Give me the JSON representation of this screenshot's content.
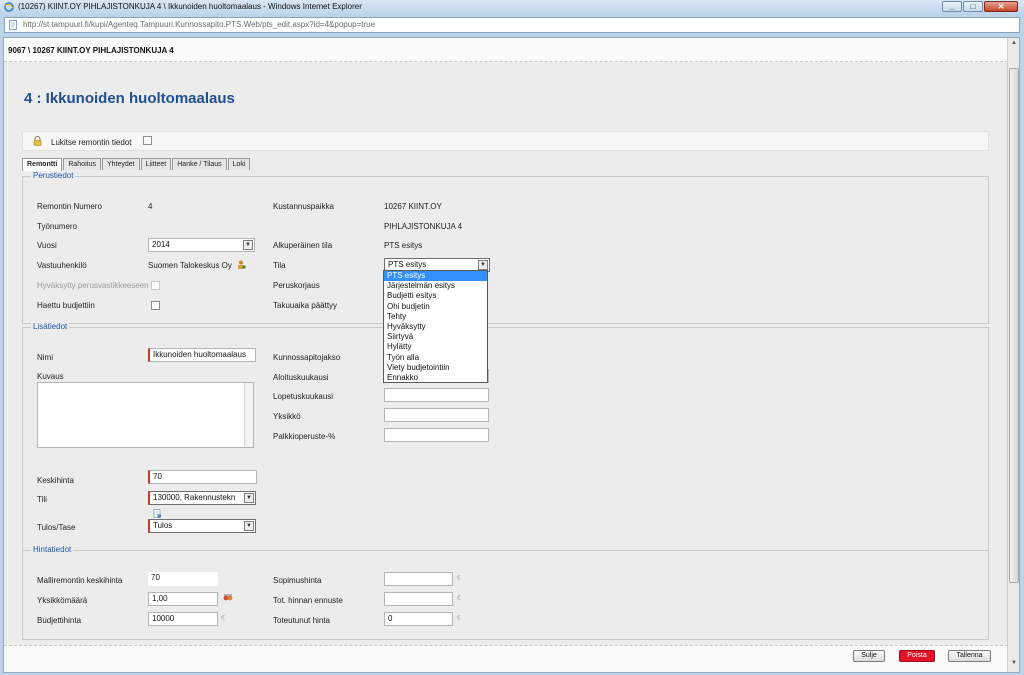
{
  "window": {
    "title": "(10267) KIINT.OY PIHLAJISTONKUJA 4 \\ Ikkunoiden huoltomaalaus - Windows Internet Explorer",
    "url": "http://st.tampuuri.fi/kupi/Agenteq.Tampuuri.Kunnossapito.PTS.Web/pts_edit.aspx?id=4&popup=true"
  },
  "breadcrumb": "9067 \\ 10267 KIINT.OY PIHLAJISTONKUJA 4",
  "page_title": "4 : Ikkunoiden huoltomaalaus",
  "lock": {
    "label": "Lukitse remontin tiedot"
  },
  "tabs": [
    "Remontti",
    "Rahoitus",
    "Yhteydet",
    "Liitteet",
    "Hanke / Tilaus",
    "Loki"
  ],
  "perustiedot": {
    "legend": "Perustiedot",
    "remontin_numero_label": "Remontin Numero",
    "remontin_numero": "4",
    "tyonumero_label": "Työnumero",
    "vuosi_label": "Vuosi",
    "vuosi": "2014",
    "vastuuhenkilo_label": "Vastuuhenkilö",
    "vastuuhenkilo": "Suomen Talokeskus Oy",
    "hyvaksytty_label": "Hyväksytty perusvastikkeeseen",
    "haettu_label": "Haettu budjettiin",
    "kustannuspaikka_label": "Kustannuspaikka",
    "kustannuspaikka_1": "10267 KIINT.OY",
    "kustannuspaikka_2": "PIHLAJISTONKUJA 4",
    "alkuperainen_tila_label": "Alkuperäinen tila",
    "alkuperainen_tila": "PTS esitys",
    "tila_label": "Tila",
    "tila": "PTS esitys",
    "peruskorjaus_label": "Peruskorjaus",
    "takuuaika_label": "Takuuaika päättyy"
  },
  "tila_options": [
    "PTS esitys",
    "Järjestelmän esitys",
    "Budjetti esitys",
    "Ohi budjetin",
    "Tehty",
    "Hyväksytty",
    "Siirtyvä",
    "Hylätty",
    "Työn alla",
    "Viety budjetointiin",
    "Ennakko"
  ],
  "lisatiedot": {
    "legend": "Lisätiedot",
    "nimi_label": "Nimi",
    "nimi": "Ikkunoiden huoltomaalaus",
    "kuvaus_label": "Kuvaus",
    "keskihinta_label": "Keskihinta",
    "keskihinta": "70",
    "tili_label": "Tili",
    "tili": "130000, Rakennustekn",
    "tulos_label": "Tulos/Tase",
    "tulos": "Tulos",
    "kunnossapitojakso_label": "Kunnossapitojakso",
    "aloituskuukausi_label": "Aloituskuukausi",
    "lopetuskuukausi_label": "Lopetuskuukausi",
    "yksikko_label": "Yksikkö",
    "palkkioperuste_label": "Palkkioperuste-%"
  },
  "hintatiedot": {
    "legend": "Hintatiedot",
    "malliremontin_label": "Malliremontin keskihinta",
    "malliremontin": "70",
    "yksikkomaara_label": "Yksikkömäärä",
    "yksikkomaara": "1,00",
    "budjettihinta_label": "Budjettihinta",
    "budjettihinta": "10000",
    "sopimushinta_label": "Sopimushinta",
    "ennuste_label": "Tot. hinnan ennuste",
    "toteutunut_label": "Toteutunut hinta",
    "toteutunut": "0",
    "currency": "€"
  },
  "buttons": {
    "sulje": "Sulje",
    "poista": "Poista",
    "tallenna": "Tallenna"
  }
}
